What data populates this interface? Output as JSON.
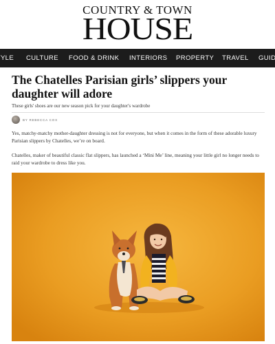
{
  "masthead": {
    "top": "COUNTRY & TOWN",
    "main": "HOUSE"
  },
  "nav": {
    "items": [
      "STYLE",
      "CULTURE",
      "FOOD & DRINK",
      "INTERIORS",
      "PROPERTY",
      "TRAVEL",
      "GUIDES"
    ]
  },
  "article": {
    "title": "The Chatelles Parisian girls’ slippers your daughter will adore",
    "standfirst": "These girls' shoes are our new season pick for your daughter's wardrobe",
    "byline": "BY REBECCA COX",
    "paragraphs": [
      "Yes, matchy-matchy mother-daughter dressing is not for everyone, but when it comes in the form of these adorable luxury Parisian slippers by Chatelles, we’re on board.",
      "Chatelles, maker of beautiful classic flat slippers, has launched a ‘Mini Me’ line, meaning your little girl no longer needs to raid your wardrobe to dress like you."
    ]
  },
  "colors": {
    "nav_bg": "#1c1c1c",
    "photo_bg": "#e89a1e"
  }
}
